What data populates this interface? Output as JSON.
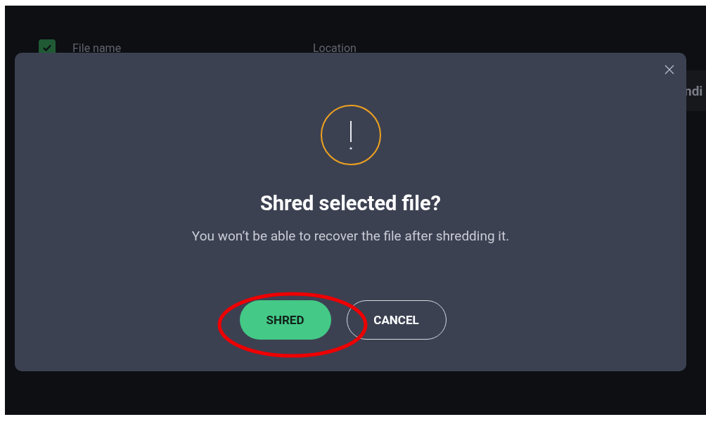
{
  "background_table": {
    "header_checkbox": {
      "checked": true
    },
    "columns": [
      "File name",
      "Location"
    ],
    "row_text": "ndi"
  },
  "dialog": {
    "title": "Shred selected file?",
    "message": "You won’t be able to recover the file after shredding it.",
    "buttons": [
      {
        "label": "SHRED",
        "kind": "primary"
      },
      {
        "label": "CANCEL",
        "kind": "secondary"
      }
    ]
  },
  "annotation": {
    "shred_button_circled": true
  }
}
